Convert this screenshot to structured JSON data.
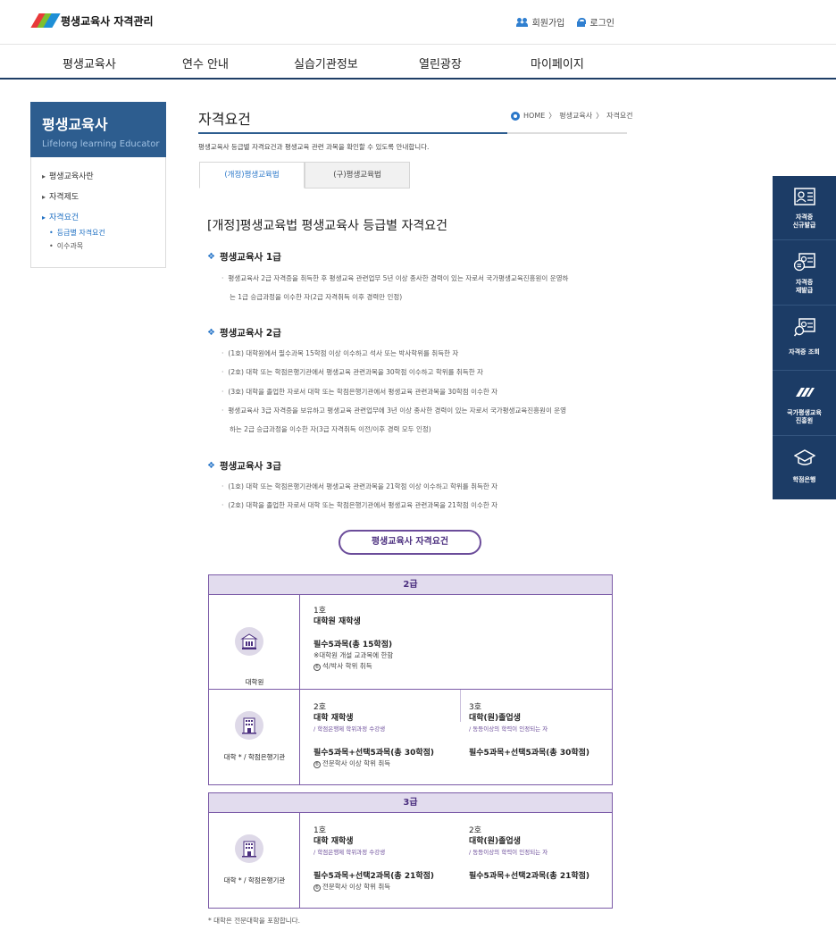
{
  "header": {
    "site_title": "평생교육사 자격관리",
    "signup": "회원가입",
    "login": "로그인"
  },
  "gnb": [
    "평생교육사",
    "연수 안내",
    "실습기관정보",
    "열린광장",
    "마이페이지"
  ],
  "sidebar": {
    "title": "평생교육사",
    "subtitle": "Lifelong learning Educator",
    "menu": [
      "평생교육사란",
      "자격제도",
      "자격요건"
    ],
    "submenu": [
      "등급별 자격요건",
      "이수과목"
    ]
  },
  "content": {
    "title": "자격요건",
    "breadcrumb": [
      "HOME",
      "〉",
      "평생교육사",
      "〉",
      "자격요건"
    ],
    "lead": "평생교육사 등급별 자격요건과 평생교육 관련 과목을 확인할 수 있도록 안내합니다.",
    "tabs": [
      "(개정)평생교육법",
      "(구)평생교육법"
    ],
    "heading": "[개정]평생교육법 평생교육사 등급별 자격요건",
    "grade1": {
      "title": "평생교육사 1급",
      "items": [
        "평생교육사 2급 자격증을 취득한 후 평생교육 관련업무 5년 이상 종사한 경력이 있는 자로서 국가평생교육진흥원이 운영하",
        "는 1급 승급과정을 이수한 자(2급 자격취득 이후 경력만 인정)"
      ]
    },
    "grade2": {
      "title": "평생교육사 2급",
      "items": [
        "(1호) 대학원에서 필수과목 15학점 이상 이수하고 석사 또는 박사학위를 취득한 자",
        "(2호) 대학 또는 학점은행기관에서 평생교육 관련과목을 30학점 이수하고 학위를 취득한 자",
        "(3호) 대학을 졸업한 자로서 대학 또는 학점은행기관에서 평생교육 관련과목을 30학점 이수한 자",
        "평생교육사 3급 자격증을 보유하고 평생교육 관련업무에 3년 이상 종사한 경력이 있는 자로서 국가평생교육진흥원이 운영",
        "하는 2급 승급과정을 이수한 자(3급 자격취득 이전/이후 경력 모두 인정)"
      ]
    },
    "grade3": {
      "title": "평생교육사 3급",
      "items": [
        "(1호) 대학 또는 학점은행기관에서 평생교육 관련과목을 21학점 이상 이수하고 학위를 취득한 자",
        "(2호) 대학을 졸업한 자로서 대학 또는 학점은행기관에서 평생교육 관련과목을 21학점 이수한 자"
      ]
    },
    "pill": "평생교육사 자격요건",
    "table2": {
      "head": "2급",
      "row1": {
        "label": "대학원",
        "no": "1호",
        "target": "대학원 재학생",
        "body": "필수5과목(총 15학점)",
        "note1": "※대학원 개설 교과목에 한함",
        "note2": "석/박사 학위 취득"
      },
      "row2": {
        "label": "대학 * / 학점은행기관",
        "a_no": "2호",
        "a_target": "대학 재학생",
        "a_sub": "/ 학점은행제 학위과정 수강생",
        "a_body": "필수5과목+선택5과목(총 30학점)",
        "a_note": "전문학사 이상 학위 취득",
        "b_no": "3호",
        "b_target": "대학(원)졸업생",
        "b_sub": "/ 동등이상의 학력이 인정되는 자",
        "b_body": "필수5과목+선택5과목(총 30학점)"
      }
    },
    "table3": {
      "head": "3급",
      "row1": {
        "label": "대학 * / 학점은행기관",
        "a_no": "1호",
        "a_target": "대학 재학생",
        "a_sub": "/ 학점은행제 학위과정 수강생",
        "a_body": "필수5과목+선택2과목(총 21학점)",
        "a_note": "전문학사 이상 학위 취득",
        "b_no": "2호",
        "b_target": "대학(원)졸업생",
        "b_sub": "/ 동등이상의 학력이 인정되는 자",
        "b_body": "필수5과목+선택2과목(총 21학점)"
      }
    },
    "footnote": "* 대학은 전문대학을 포함합니다."
  },
  "quick": [
    [
      "자격증",
      "신규발급"
    ],
    [
      "자격증",
      "재발급"
    ],
    [
      "자격증 조회"
    ],
    [
      "국가평생교육",
      "진흥원"
    ],
    [
      "학점은행"
    ]
  ],
  "colors": {
    "navy": "#1c3c66",
    "blue": "#2a77c9",
    "purple": "#6b4c9a",
    "side": "#2d5d8f"
  }
}
